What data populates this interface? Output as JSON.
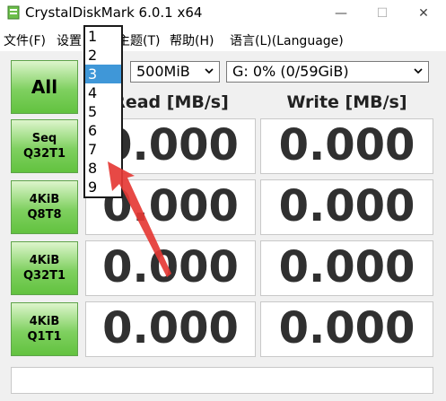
{
  "window": {
    "title": "CrystalDiskMark 6.0.1 x64",
    "minimize_glyph": "—",
    "maximize_glyph": "☐",
    "close_glyph": "✕"
  },
  "menu": {
    "file": "文件(F)",
    "settings": "设置",
    "theme": "主题(T)",
    "help": "帮助(H)",
    "language": "语言(L)(Language)"
  },
  "controls": {
    "all_button": "All",
    "size_select": "500MiB",
    "drive_select": "G: 0% (0/59GiB)"
  },
  "headers": {
    "read": "Read [MB/s]",
    "write": "Write [MB/s]"
  },
  "tests": [
    {
      "line1": "Seq",
      "line2": "Q32T1",
      "read": "0.000",
      "write": "0.000"
    },
    {
      "line1": "4KiB",
      "line2": "Q8T8",
      "read": "0.000",
      "write": "0.000"
    },
    {
      "line1": "4KiB",
      "line2": "Q32T1",
      "read": "0.000",
      "write": "0.000"
    },
    {
      "line1": "4KiB",
      "line2": "Q1T1",
      "read": "0.000",
      "write": "0.000"
    }
  ],
  "dropdown": {
    "items": [
      "1",
      "2",
      "3",
      "4",
      "5",
      "6",
      "7",
      "8",
      "9"
    ],
    "selected": "3"
  },
  "colors": {
    "accent_selection": "#3f97d8",
    "button_green": "#7fd060",
    "annotation_arrow": "#e53935"
  }
}
